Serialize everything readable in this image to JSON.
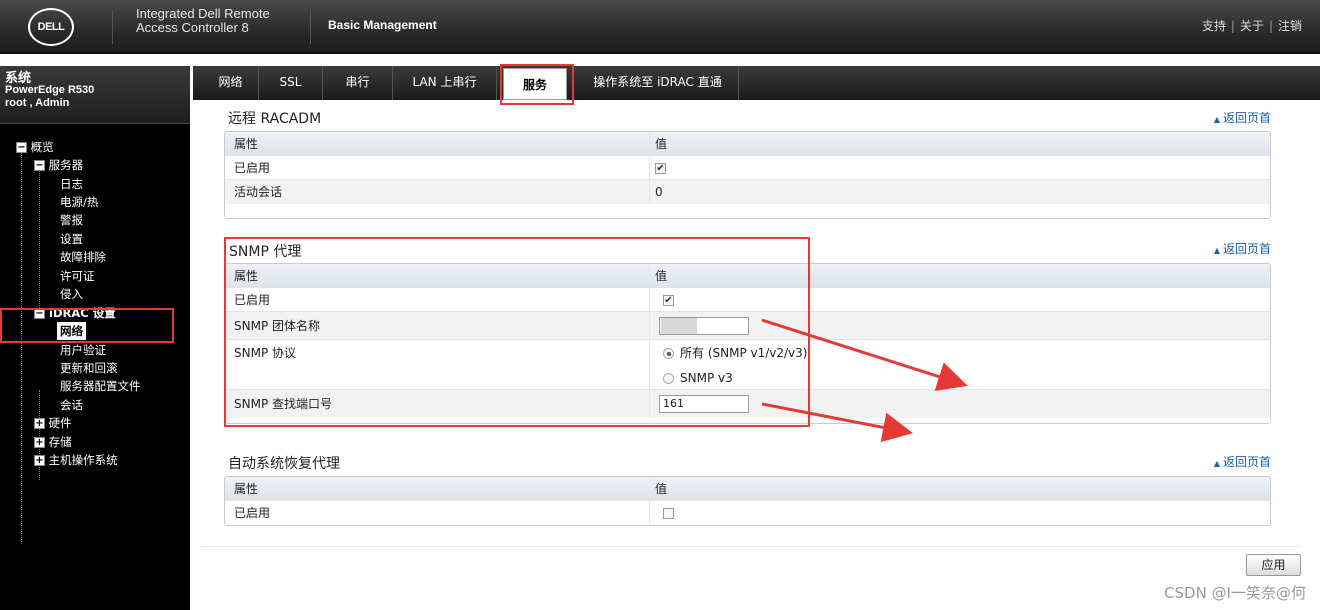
{
  "header": {
    "logo": "DELL",
    "product_line1": "Integrated Dell Remote",
    "product_line2": "Access Controller 8",
    "management": "Basic Management",
    "links": [
      "支持",
      "关于",
      "注销"
    ]
  },
  "system": {
    "title": "系统",
    "model": "PowerEdge R530",
    "user": "root , Admin"
  },
  "tree": {
    "overview": "概览",
    "server": "服务器",
    "log": "日志",
    "power": "电源/热",
    "alert": "警报",
    "settings": "设置",
    "troubleshoot": "故障排除",
    "license": "许可证",
    "intrusion": "侵入",
    "idrac": "iDRAC 设置",
    "network": "网络",
    "user_auth": "用户验证",
    "update": "更新和回滚",
    "profile": "服务器配置文件",
    "sessions": "会话",
    "hardware": "硬件",
    "storage": "存储",
    "host_os": "主机操作系统"
  },
  "tabs": [
    "网络",
    "SSL",
    "串行",
    "LAN 上串行",
    "服务",
    "操作系统至 iDRAC 直通"
  ],
  "active_tab": "服务",
  "back_to_top": "返回页首",
  "racadm": {
    "title": "远程 RACADM",
    "col_attr": "属性",
    "col_val": "值",
    "enabled_label": "已启用",
    "sessions_label": "活动会话",
    "sessions_value": "0"
  },
  "snmp": {
    "title": "SNMP 代理",
    "col_attr": "属性",
    "col_val": "值",
    "enabled_label": "已启用",
    "community_label": "SNMP 团体名称",
    "protocol_label": "SNMP 协议",
    "protocol_all": "所有 (SNMP v1/v2/v3)",
    "protocol_v3": "SNMP v3",
    "port_label": "SNMP 查找端口号",
    "port_value": "161"
  },
  "asr": {
    "title": "自动系统恢复代理",
    "col_attr": "属性",
    "col_val": "值",
    "enabled_label": "已启用"
  },
  "apply_label": "应用",
  "watermark": "CSDN @I一笑奈@何",
  "colors": {
    "highlight": "#e53935",
    "link": "#1a5fa8"
  }
}
